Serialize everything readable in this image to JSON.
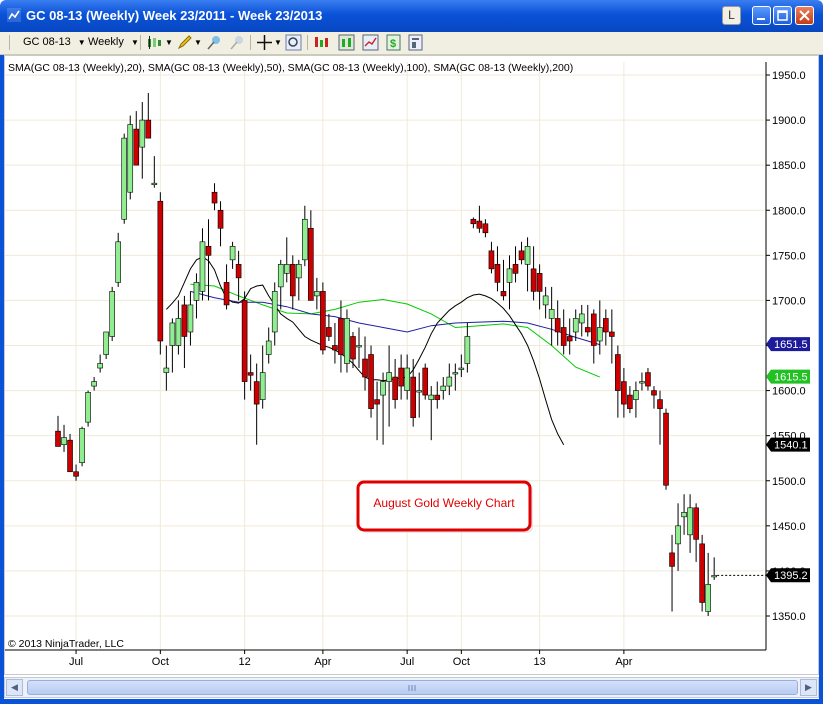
{
  "window": {
    "title": "GC 08-13 (Weekly)  Week 23/2011 - Week 23/2013",
    "link_btn": "L"
  },
  "toolbar": {
    "instrument": "GC 08-13",
    "period": "Weekly"
  },
  "chart_data": {
    "type": "candlestick",
    "indicator_label": "SMA(GC 08-13 (Weekly),20), SMA(GC 08-13 (Weekly),50), SMA(GC 08-13 (Weekly),100), SMA(GC 08-13 (Weekly),200)",
    "ylim": [
      1320,
      1960
    ],
    "y_ticks": [
      1350.0,
      1400.0,
      1450.0,
      1500.0,
      1550.0,
      1600.0,
      1650.0,
      1700.0,
      1750.0,
      1800.0,
      1850.0,
      1900.0,
      1950.0
    ],
    "y_tick_labels": [
      "1350.0",
      "1400.0",
      "1450.0",
      "1500.0",
      "1550.0",
      "1600.0",
      "1650.0",
      "1700.0",
      "1750.0",
      "1800.0",
      "1850.0",
      "1900.0",
      "1950.0"
    ],
    "x_tick_labels": [
      {
        "index": 3,
        "label": "Jul"
      },
      {
        "index": 17,
        "label": "Oct"
      },
      {
        "index": 31,
        "label": "12"
      },
      {
        "index": 44,
        "label": "Apr"
      },
      {
        "index": 58,
        "label": "Jul"
      },
      {
        "index": 67,
        "label": "Oct"
      },
      {
        "index": 80,
        "label": "13"
      },
      {
        "index": 94,
        "label": "Apr"
      }
    ],
    "candles": [
      [
        1555,
        1572,
        1540,
        1538
      ],
      [
        1540,
        1562,
        1532,
        1548
      ],
      [
        1545,
        1552,
        1510,
        1510
      ],
      [
        1510,
        1518,
        1500,
        1505
      ],
      [
        1520,
        1560,
        1516,
        1558
      ],
      [
        1565,
        1600,
        1560,
        1598
      ],
      [
        1605,
        1615,
        1600,
        1610
      ],
      [
        1625,
        1640,
        1620,
        1630
      ],
      [
        1640,
        1665,
        1635,
        1665
      ],
      [
        1660,
        1715,
        1655,
        1710
      ],
      [
        1720,
        1775,
        1715,
        1765
      ],
      [
        1790,
        1885,
        1785,
        1880
      ],
      [
        1820,
        1905,
        1812,
        1895
      ],
      [
        1890,
        1910,
        1865,
        1850
      ],
      [
        1870,
        1920,
        1835,
        1900
      ],
      [
        1900,
        1930,
        1880,
        1880
      ],
      [
        1830,
        1860,
        1825,
        1830
      ],
      [
        1810,
        1820,
        1640,
        1655
      ],
      [
        1620,
        1650,
        1600,
        1625
      ],
      [
        1650,
        1680,
        1620,
        1675
      ],
      [
        1650,
        1700,
        1640,
        1680
      ],
      [
        1695,
        1705,
        1625,
        1660
      ],
      [
        1665,
        1710,
        1650,
        1695
      ],
      [
        1700,
        1730,
        1680,
        1720
      ],
      [
        1710,
        1780,
        1700,
        1765
      ],
      [
        1760,
        1790,
        1700,
        1750
      ],
      [
        1820,
        1830,
        1800,
        1808
      ],
      [
        1800,
        1810,
        1760,
        1780
      ],
      [
        1720,
        1740,
        1690,
        1695
      ],
      [
        1745,
        1765,
        1735,
        1760
      ],
      [
        1740,
        1755,
        1700,
        1725
      ],
      [
        1700,
        1710,
        1590,
        1610
      ],
      [
        1620,
        1640,
        1600,
        1617
      ],
      [
        1610,
        1630,
        1540,
        1585
      ],
      [
        1590,
        1650,
        1580,
        1620
      ],
      [
        1640,
        1670,
        1630,
        1655
      ],
      [
        1665,
        1720,
        1650,
        1710
      ],
      [
        1715,
        1745,
        1690,
        1740
      ],
      [
        1730,
        1770,
        1720,
        1740
      ],
      [
        1740,
        1750,
        1690,
        1705
      ],
      [
        1725,
        1745,
        1700,
        1740
      ],
      [
        1745,
        1805,
        1738,
        1790
      ],
      [
        1780,
        1800,
        1700,
        1700
      ],
      [
        1705,
        1725,
        1690,
        1710
      ],
      [
        1710,
        1720,
        1640,
        1645
      ],
      [
        1670,
        1685,
        1655,
        1660
      ],
      [
        1650,
        1675,
        1630,
        1645
      ],
      [
        1680,
        1700,
        1620,
        1640
      ],
      [
        1630,
        1690,
        1620,
        1680
      ],
      [
        1660,
        1665,
        1625,
        1635
      ],
      [
        1650,
        1670,
        1625,
        1650
      ],
      [
        1635,
        1660,
        1600,
        1615
      ],
      [
        1640,
        1650,
        1570,
        1580
      ],
      [
        1590,
        1610,
        1545,
        1585
      ],
      [
        1595,
        1620,
        1540,
        1610
      ],
      [
        1610,
        1650,
        1560,
        1620
      ],
      [
        1615,
        1635,
        1580,
        1590
      ],
      [
        1625,
        1640,
        1590,
        1605
      ],
      [
        1600,
        1640,
        1590,
        1625
      ],
      [
        1615,
        1635,
        1560,
        1570
      ],
      [
        1600,
        1620,
        1570,
        1600
      ],
      [
        1625,
        1630,
        1590,
        1595
      ],
      [
        1590,
        1605,
        1545,
        1595
      ],
      [
        1595,
        1610,
        1580,
        1590
      ],
      [
        1600,
        1615,
        1590,
        1605
      ],
      [
        1605,
        1630,
        1595,
        1615
      ],
      [
        1620,
        1630,
        1600,
        1620
      ],
      [
        1625,
        1640,
        1615,
        1625
      ],
      [
        1630,
        1675,
        1620,
        1660
      ],
      [
        1790,
        1792,
        1780,
        1785
      ],
      [
        1788,
        1805,
        1775,
        1780
      ],
      [
        1785,
        1790,
        1770,
        1775
      ],
      [
        1755,
        1765,
        1730,
        1735
      ],
      [
        1740,
        1760,
        1710,
        1720
      ],
      [
        1710,
        1745,
        1700,
        1705
      ],
      [
        1720,
        1750,
        1690,
        1735
      ],
      [
        1740,
        1760,
        1720,
        1730
      ],
      [
        1755,
        1765,
        1740,
        1745
      ],
      [
        1740,
        1770,
        1710,
        1760
      ],
      [
        1735,
        1760,
        1700,
        1710
      ],
      [
        1730,
        1740,
        1690,
        1710
      ],
      [
        1695,
        1715,
        1680,
        1705
      ],
      [
        1680,
        1715,
        1650,
        1690
      ],
      [
        1680,
        1700,
        1650,
        1665
      ],
      [
        1670,
        1690,
        1640,
        1650
      ],
      [
        1660,
        1680,
        1640,
        1655
      ],
      [
        1665,
        1690,
        1655,
        1680
      ],
      [
        1675,
        1695,
        1660,
        1685
      ],
      [
        1670,
        1695,
        1660,
        1665
      ],
      [
        1685,
        1690,
        1630,
        1650
      ],
      [
        1655,
        1700,
        1640,
        1670
      ],
      [
        1680,
        1690,
        1650,
        1665
      ],
      [
        1665,
        1690,
        1630,
        1660
      ],
      [
        1640,
        1650,
        1570,
        1600
      ],
      [
        1610,
        1625,
        1570,
        1585
      ],
      [
        1595,
        1605,
        1575,
        1580
      ],
      [
        1590,
        1610,
        1570,
        1600
      ],
      [
        1610,
        1620,
        1600,
        1610
      ],
      [
        1620,
        1625,
        1600,
        1605
      ],
      [
        1600,
        1605,
        1580,
        1595
      ],
      [
        1590,
        1600,
        1540,
        1580
      ],
      [
        1575,
        1580,
        1490,
        1495
      ],
      [
        1420,
        1440,
        1355,
        1405
      ],
      [
        1430,
        1475,
        1400,
        1450
      ],
      [
        1460,
        1485,
        1440,
        1465
      ],
      [
        1440,
        1485,
        1420,
        1470
      ],
      [
        1470,
        1475,
        1410,
        1435
      ],
      [
        1430,
        1440,
        1355,
        1365
      ],
      [
        1355,
        1420,
        1350,
        1385
      ],
      [
        1395,
        1415,
        1390,
        1395
      ]
    ],
    "sma20": [
      [
        18,
        1690
      ],
      [
        19,
        1697
      ],
      [
        20,
        1705
      ],
      [
        21,
        1720
      ],
      [
        22,
        1735
      ],
      [
        23,
        1745
      ],
      [
        24,
        1748
      ],
      [
        25,
        1744
      ],
      [
        26,
        1734
      ],
      [
        27,
        1716
      ],
      [
        28,
        1702
      ],
      [
        29,
        1698
      ],
      [
        30,
        1697
      ],
      [
        31,
        1702
      ],
      [
        32,
        1713
      ],
      [
        33,
        1716
      ],
      [
        34,
        1717
      ],
      [
        35,
        1705
      ],
      [
        36,
        1695
      ],
      [
        37,
        1685
      ],
      [
        38,
        1680
      ],
      [
        39,
        1676
      ],
      [
        40,
        1668
      ],
      [
        41,
        1660
      ],
      [
        42,
        1656
      ],
      [
        43,
        1653
      ],
      [
        44,
        1650
      ],
      [
        45,
        1648
      ],
      [
        46,
        1645
      ],
      [
        47,
        1641
      ],
      [
        48,
        1636
      ],
      [
        49,
        1630
      ],
      [
        50,
        1622
      ],
      [
        51,
        1615
      ],
      [
        52,
        1612
      ],
      [
        53,
        1612
      ],
      [
        54,
        1611
      ],
      [
        55,
        1612
      ],
      [
        56,
        1613
      ],
      [
        57,
        1614
      ],
      [
        58,
        1615
      ],
      [
        59,
        1623
      ],
      [
        60,
        1635
      ],
      [
        61,
        1648
      ],
      [
        62,
        1663
      ],
      [
        63,
        1675
      ],
      [
        64,
        1682
      ],
      [
        65,
        1689
      ],
      [
        66,
        1694
      ],
      [
        67,
        1698
      ],
      [
        68,
        1703
      ],
      [
        69,
        1706
      ],
      [
        70,
        1707
      ],
      [
        71,
        1705
      ],
      [
        72,
        1702
      ],
      [
        73,
        1697
      ],
      [
        74,
        1691
      ],
      [
        75,
        1683
      ],
      [
        76,
        1673
      ],
      [
        77,
        1663
      ],
      [
        78,
        1650
      ],
      [
        79,
        1633
      ],
      [
        80,
        1613
      ],
      [
        81,
        1590
      ],
      [
        82,
        1568
      ],
      [
        83,
        1552
      ],
      [
        84,
        1540
      ]
    ],
    "sma50": [
      [
        22,
        1718
      ],
      [
        26,
        1716
      ],
      [
        30,
        1705
      ],
      [
        34,
        1695
      ],
      [
        38,
        1686
      ],
      [
        42,
        1685
      ],
      [
        46,
        1690
      ],
      [
        50,
        1698
      ],
      [
        54,
        1701
      ],
      [
        58,
        1696
      ],
      [
        62,
        1685
      ],
      [
        66,
        1670
      ],
      [
        70,
        1672
      ],
      [
        74,
        1674
      ],
      [
        78,
        1670
      ],
      [
        82,
        1650
      ],
      [
        86,
        1626
      ],
      [
        90,
        1615
      ]
    ],
    "sma100": [
      [
        22,
        1710
      ],
      [
        26,
        1703
      ],
      [
        30,
        1698
      ],
      [
        34,
        1698
      ],
      [
        38,
        1693
      ],
      [
        42,
        1685
      ],
      [
        46,
        1682
      ],
      [
        50,
        1675
      ],
      [
        54,
        1670
      ],
      [
        58,
        1665
      ],
      [
        62,
        1672
      ],
      [
        66,
        1675
      ],
      [
        70,
        1676
      ],
      [
        74,
        1677
      ],
      [
        78,
        1675
      ],
      [
        82,
        1668
      ],
      [
        86,
        1659
      ],
      [
        90,
        1651
      ]
    ],
    "price_markers": [
      {
        "label": "1651.5",
        "value": 1651.5,
        "bg": "#1c1c9b",
        "fg": "#ffffff"
      },
      {
        "label": "1615.5",
        "value": 1615.5,
        "bg": "#22c022",
        "fg": "#ffffff"
      },
      {
        "label": "1540.1",
        "value": 1540.1,
        "bg": "#000000",
        "fg": "#ffffff"
      },
      {
        "label": "1395.2",
        "value": 1395.2,
        "bg": "#000000",
        "fg": "#ffffff"
      }
    ],
    "annotation": "August Gold Weekly Chart",
    "copyright": "© 2013 NinjaTrader, LLC",
    "colors": {
      "up": "#90ee90",
      "down": "#cc0000",
      "sma20": "#000000",
      "sma50": "#00cc00",
      "sma100": "#1e1ea0"
    }
  }
}
